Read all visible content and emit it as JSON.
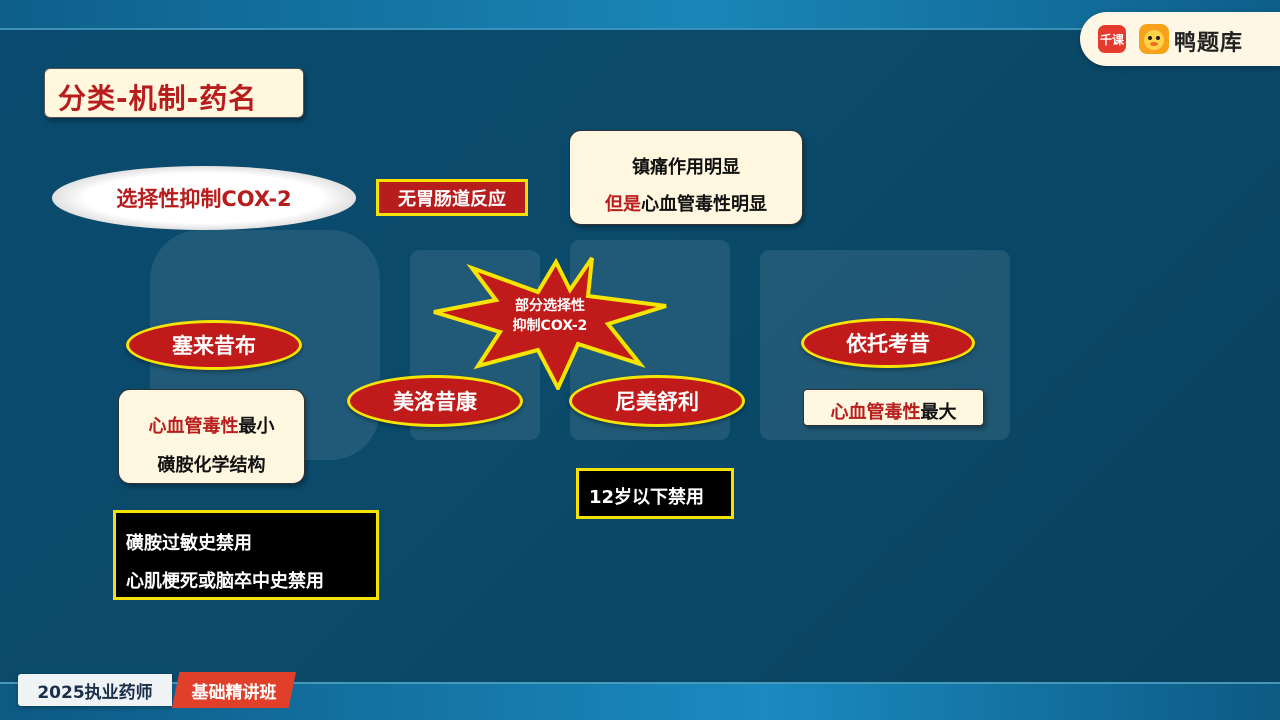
{
  "brand": {
    "badge": "千课",
    "name": "鸭题库"
  },
  "slide": {
    "title": "分类-机制-药名",
    "cox2_selective": "选择性抑制COX-2",
    "no_gi": "无胃肠道反应",
    "analgesic_note": {
      "line1": "镇痛作用明显",
      "line2_red": "但是",
      "line2_black": "心血管毒性明显"
    },
    "center_star": {
      "line1": "部分选择性",
      "line2": "抑制COX-2"
    },
    "drugs": {
      "celecoxib": "塞来昔布",
      "etoricoxib": "依托考昔",
      "meloxicam": "美洛昔康",
      "nimesulide": "尼美舒利"
    },
    "celecoxib_note": {
      "line1_red": "心血管毒性",
      "line1_black": "最小",
      "line2": "磺胺化学结构"
    },
    "etoricoxib_note": {
      "red": "心血管毒性",
      "black": "最大"
    },
    "nimesulide_note": "12岁以下禁用",
    "contraindications": {
      "line1": "磺胺过敏史禁用",
      "line2": "心肌梗死或脑卒中史禁用"
    }
  },
  "footer": {
    "course": "2025执业药师",
    "level": "基础精讲班"
  },
  "colors": {
    "red": "#b81d1d",
    "yellow": "#f5e200",
    "cream": "#fff7df",
    "background": "#0b4a6a"
  },
  "icons": [
    "duck-logo-icon",
    "watermark-duck-icon"
  ]
}
